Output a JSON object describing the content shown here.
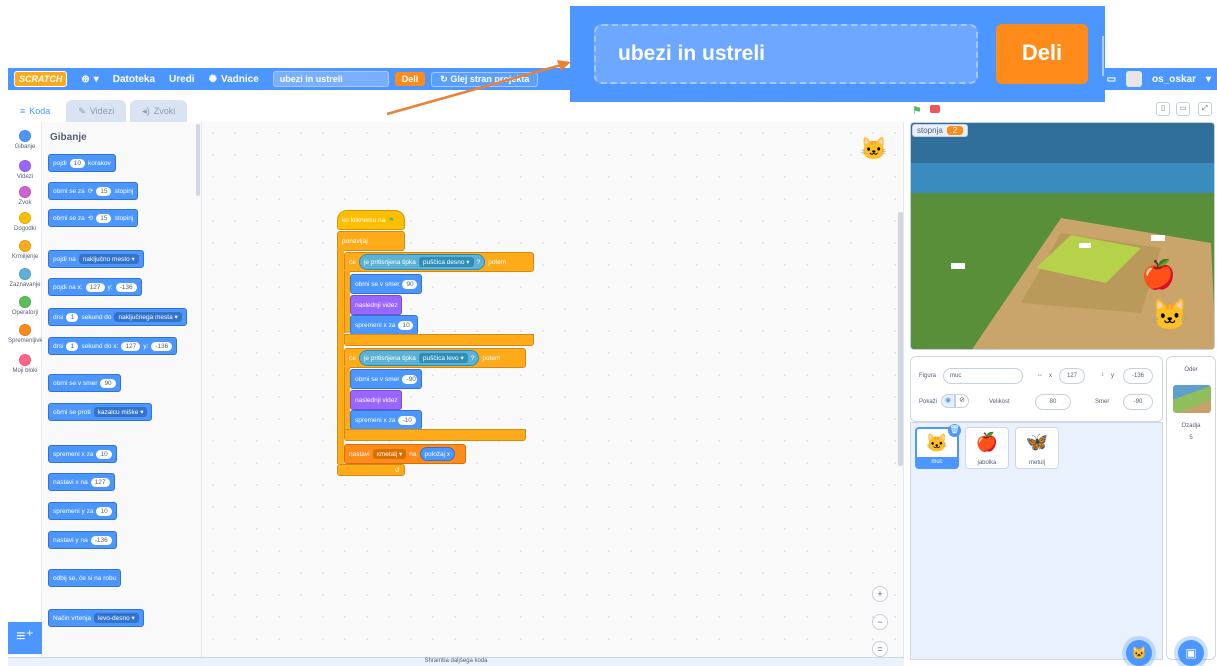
{
  "menubar": {
    "logo": "SCRATCH",
    "file": "Datoteka",
    "edit": "Uredi",
    "tutorials": "Vadnice",
    "project_title": "ubezi in ustreli",
    "share": "Deli",
    "see_project_page": "Glej stran projekta",
    "username": "os_oskar"
  },
  "callout": {
    "project_title": "ubezi in ustreli",
    "share": "Deli"
  },
  "tabs": [
    "Koda",
    "Videzi",
    "Zvoki"
  ],
  "categories": [
    {
      "label": "Gibanje",
      "color": "#4c97ff"
    },
    {
      "label": "Videzi",
      "color": "#9966ff"
    },
    {
      "label": "Zvok",
      "color": "#cf63cf"
    },
    {
      "label": "Dogodki",
      "color": "#ffbf00"
    },
    {
      "label": "Krmiljenje",
      "color": "#ffab19"
    },
    {
      "label": "Zaznavanje",
      "color": "#5cb1d6"
    },
    {
      "label": "Operatorji",
      "color": "#59c059"
    },
    {
      "label": "Spremenljivke",
      "color": "#ff8c1a"
    },
    {
      "label": "Moji bloki",
      "color": "#ff6680"
    }
  ],
  "palette": {
    "title": "Gibanje",
    "blocks": [
      {
        "parts": [
          "pojdi",
          "10",
          "korakov"
        ]
      },
      {
        "parts": [
          "obrni se za",
          "⟳",
          "15",
          "stopinj"
        ]
      },
      {
        "parts": [
          "obrni se za",
          "⟲",
          "15",
          "stopinj"
        ]
      },
      {
        "parts": [
          "pojdi na",
          "naključno mesto ▾"
        ]
      },
      {
        "parts": [
          "pojdi na x:",
          "127",
          "y:",
          "-136"
        ]
      },
      {
        "parts": [
          "drsi",
          "1",
          "sekund do",
          "naključnega mesta ▾"
        ]
      },
      {
        "parts": [
          "drsi",
          "1",
          "sekund do x:",
          "127",
          "y:",
          "-136"
        ]
      },
      {
        "parts": [
          "obrni se v smer",
          "90"
        ]
      },
      {
        "parts": [
          "obrni se proti",
          "kazalcu miške ▾"
        ]
      },
      {
        "parts": [
          "spremeni x za",
          "10"
        ]
      },
      {
        "parts": [
          "nastavi x na",
          "127"
        ]
      },
      {
        "parts": [
          "spremeni y za",
          "10"
        ]
      },
      {
        "parts": [
          "nastavi y na",
          "-136"
        ]
      },
      {
        "parts": [
          "odbij se, če si na robu"
        ]
      },
      {
        "parts": [
          "Način vrtenja",
          "levo-desno ▾"
        ]
      }
    ]
  },
  "script": {
    "hat": {
      "label": "ko kliknemo na",
      "flag": "⚑"
    },
    "forever": "ponavljaj",
    "if1": {
      "if": "če",
      "sensing": "je pritisnjena tipka",
      "key": "puščica desno ▾",
      "q": "?",
      "then": "potem"
    },
    "if1_body": [
      {
        "label": "obrni se v smer",
        "value": "90"
      },
      {
        "label": "naslednji videz",
        "value": ""
      },
      {
        "label": "spremeni x za",
        "value": "10"
      }
    ],
    "if2": {
      "if": "če",
      "sensing": "je pritisnjena tipka",
      "key": "puščica levo ▾",
      "q": "?",
      "then": "potem"
    },
    "if2_body": [
      {
        "label": "obrni se v smer",
        "value": "-90"
      },
      {
        "label": "naslednji videz",
        "value": ""
      },
      {
        "label": "spremeni x za",
        "value": "-10"
      }
    ],
    "set_var": {
      "label": "nastavi",
      "var": "xmetalj ▾",
      "to": "na",
      "reporter": "položaj x"
    },
    "loop_arrow": "↺"
  },
  "bottom_bar": "Shramba daljšega koda",
  "stage": {
    "variable_name": "stopnja",
    "variable_value": "2"
  },
  "sprite_info": {
    "sprite_label": "Figura",
    "sprite_name": "muc",
    "x_label": "x",
    "x": "127",
    "y_label": "y",
    "y": "-136",
    "show_label": "Pokaži",
    "size_label": "Velikost",
    "size": "80",
    "direction_label": "Smer",
    "direction": "-90"
  },
  "sprites": [
    {
      "name": "muc",
      "icon": "🐱"
    },
    {
      "name": "jabolka",
      "icon": "🍎"
    },
    {
      "name": "metulj",
      "icon": "🦋"
    }
  ],
  "backdrop": {
    "title": "Oder",
    "label": "Ozadja",
    "count": "5"
  },
  "icons": {
    "globe": "globe-icon",
    "bulb": "lightbulb-icon",
    "folder": "folder-icon",
    "zoom_in": "zoom-in-icon",
    "zoom_out": "zoom-out-icon",
    "zoom_reset": "zoom-reset-icon"
  }
}
